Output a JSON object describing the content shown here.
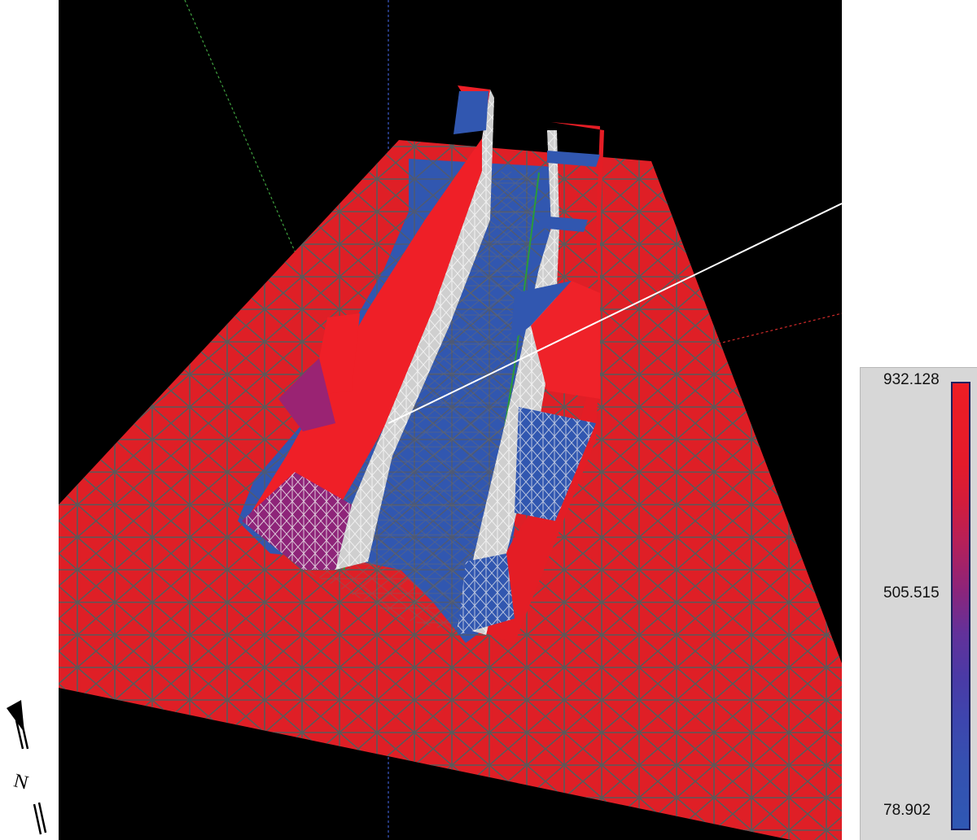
{
  "viewport": {
    "background": "#000000",
    "mesh_colors": {
      "high": "#e31d24",
      "low": "#3157b0",
      "mid": "#8e2479",
      "wireframe": "#555555",
      "building_edge": "#e8e8e8"
    }
  },
  "compass": {
    "label": "N",
    "icon": "north-arrow-icon"
  },
  "legend": {
    "max_label": "932.128",
    "mid_label": "505.515",
    "min_label": "78.902",
    "max_color": "#ee1d24",
    "min_color": "#2f58b4"
  }
}
